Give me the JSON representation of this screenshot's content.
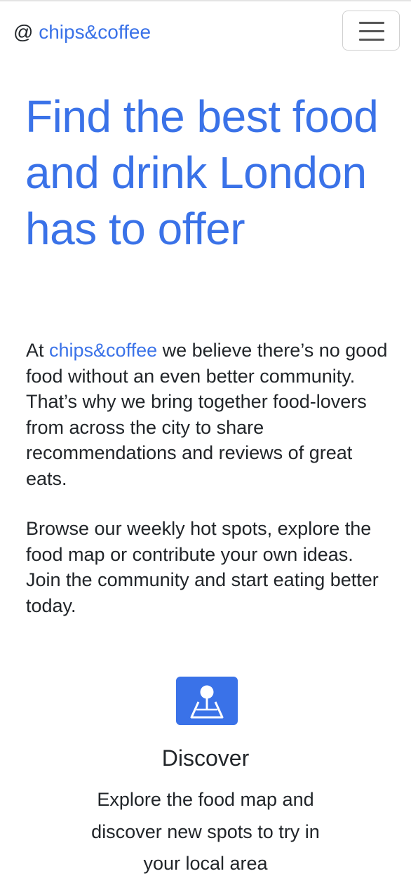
{
  "navbar": {
    "brand_at": "@",
    "brand_name": "chips&coffee",
    "menu_icon": "hamburger-menu-icon"
  },
  "hero": {
    "title": "Find the best food and drink London has to offer"
  },
  "intro": {
    "lead": "At ",
    "brand": "chips&coffee",
    "rest": " we believe there’s no good food without an even better community. That’s why we bring together food-lovers from across the city to share recommendations and reviews of great eats.",
    "paragraph2": "Browse our weekly hot spots, explore the food map or contribute your own ideas. Join the community and start eating better today."
  },
  "feature": {
    "icon": "map-pin-icon",
    "title": "Discover",
    "text": "Explore the food map and discover new spots to try in your local area"
  },
  "colors": {
    "accent": "#3a72e8",
    "text": "#212529"
  }
}
